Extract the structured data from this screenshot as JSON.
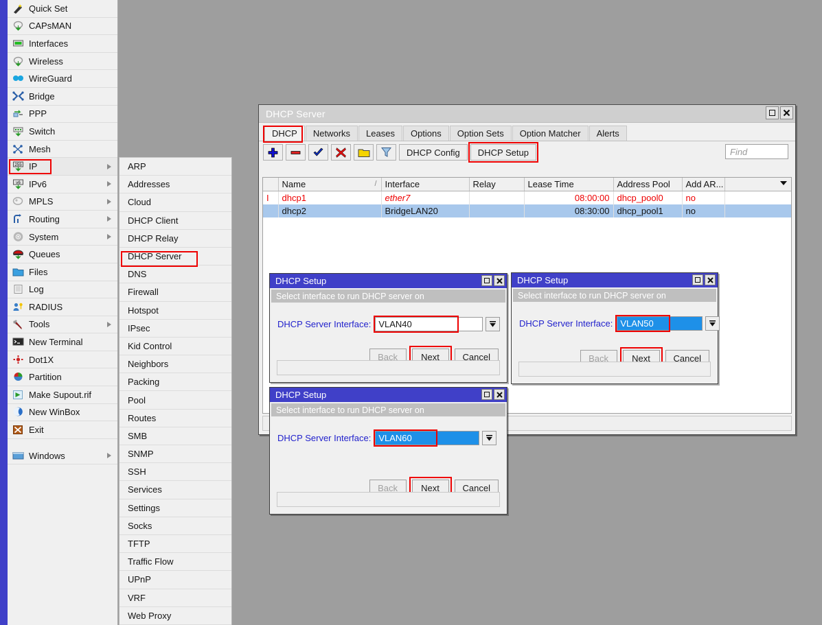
{
  "sidebar": {
    "items": [
      {
        "label": "Quick Set",
        "icon": "wand-icon",
        "submenu": false
      },
      {
        "label": "CAPsMAN",
        "icon": "capsman-icon",
        "submenu": false
      },
      {
        "label": "Interfaces",
        "icon": "interfaces-icon",
        "submenu": false
      },
      {
        "label": "Wireless",
        "icon": "wireless-icon",
        "submenu": false
      },
      {
        "label": "WireGuard",
        "icon": "wireguard-icon",
        "submenu": false
      },
      {
        "label": "Bridge",
        "icon": "bridge-icon",
        "submenu": false
      },
      {
        "label": "PPP",
        "icon": "ppp-icon",
        "submenu": false
      },
      {
        "label": "Switch",
        "icon": "switch-icon",
        "submenu": false
      },
      {
        "label": "Mesh",
        "icon": "mesh-icon",
        "submenu": false
      },
      {
        "label": "IP",
        "icon": "ip-icon",
        "submenu": true,
        "selected": true,
        "highlighted": true
      },
      {
        "label": "IPv6",
        "icon": "ipv6-icon",
        "submenu": true
      },
      {
        "label": "MPLS",
        "icon": "mpls-icon",
        "submenu": true
      },
      {
        "label": "Routing",
        "icon": "routing-icon",
        "submenu": true
      },
      {
        "label": "System",
        "icon": "system-gear-icon",
        "submenu": true
      },
      {
        "label": "Queues",
        "icon": "queues-icon",
        "submenu": false
      },
      {
        "label": "Files",
        "icon": "files-folder-icon",
        "submenu": false
      },
      {
        "label": "Log",
        "icon": "log-icon",
        "submenu": false
      },
      {
        "label": "RADIUS",
        "icon": "radius-icon",
        "submenu": false
      },
      {
        "label": "Tools",
        "icon": "tools-icon",
        "submenu": true
      },
      {
        "label": "New Terminal",
        "icon": "terminal-icon",
        "submenu": false
      },
      {
        "label": "Dot1X",
        "icon": "dot1x-icon",
        "submenu": false
      },
      {
        "label": "Partition",
        "icon": "partition-icon",
        "submenu": false
      },
      {
        "label": "Make Supout.rif",
        "icon": "supout-icon",
        "submenu": false
      },
      {
        "label": "New WinBox",
        "icon": "winbox-icon",
        "submenu": false
      },
      {
        "label": "Exit",
        "icon": "exit-icon",
        "submenu": false
      }
    ],
    "windows_item": {
      "label": "Windows",
      "icon": "windows-icon",
      "submenu": true
    }
  },
  "ip_submenu": {
    "items": [
      {
        "label": "ARP"
      },
      {
        "label": "Addresses"
      },
      {
        "label": "Cloud"
      },
      {
        "label": "DHCP Client"
      },
      {
        "label": "DHCP Relay"
      },
      {
        "label": "DHCP Server",
        "highlighted": true
      },
      {
        "label": "DNS"
      },
      {
        "label": "Firewall"
      },
      {
        "label": "Hotspot"
      },
      {
        "label": "IPsec"
      },
      {
        "label": "Kid Control"
      },
      {
        "label": "Neighbors"
      },
      {
        "label": "Packing"
      },
      {
        "label": "Pool"
      },
      {
        "label": "Routes"
      },
      {
        "label": "SMB"
      },
      {
        "label": "SNMP"
      },
      {
        "label": "SSH"
      },
      {
        "label": "Services"
      },
      {
        "label": "Settings"
      },
      {
        "label": "Socks"
      },
      {
        "label": "TFTP"
      },
      {
        "label": "Traffic Flow"
      },
      {
        "label": "UPnP"
      },
      {
        "label": "VRF"
      },
      {
        "label": "Web Proxy"
      }
    ]
  },
  "dhcp_window": {
    "title": "DHCP Server",
    "window_buttons": {
      "maximize": "□",
      "close": "✕"
    },
    "tabs": [
      {
        "label": "DHCP",
        "active": true,
        "highlighted": true
      },
      {
        "label": "Networks"
      },
      {
        "label": "Leases"
      },
      {
        "label": "Options"
      },
      {
        "label": "Option Sets"
      },
      {
        "label": "Option Matcher"
      },
      {
        "label": "Alerts"
      }
    ],
    "toolbar": {
      "add_icon": "plus-icon",
      "remove_icon": "minus-icon",
      "enable_icon": "check-icon",
      "disable_icon": "cross-icon",
      "comment_icon": "comment-folder-icon",
      "filter_icon": "filter-funnel-icon",
      "dhcp_config_label": "DHCP Config",
      "dhcp_setup_label": "DHCP Setup",
      "dhcp_setup_highlighted": true
    },
    "find": {
      "placeholder": "Find",
      "value": ""
    },
    "table": {
      "columns": [
        "",
        "Name",
        "Interface",
        "Relay",
        "Lease Time",
        "Address Pool",
        "Add AR..."
      ],
      "sort_column": "Name",
      "sort_indicator": "/",
      "rows": [
        {
          "flag": "I",
          "name": "dhcp1",
          "interface": "ether7",
          "relay": "",
          "lease_time": "08:00:00",
          "address_pool": "dhcp_pool0",
          "add_arp": "no",
          "state": "disabled"
        },
        {
          "flag": "",
          "name": "dhcp2",
          "interface": "BridgeLAN20",
          "relay": "",
          "lease_time": "08:30:00",
          "address_pool": "dhcp_pool1",
          "add_arp": "no",
          "state": "selected"
        }
      ]
    },
    "status_text": ""
  },
  "setup_dialogs": [
    {
      "id": "vlan40",
      "title": "DHCP Setup",
      "prompt": "Select interface to run DHCP server on",
      "field_label": "DHCP Server Interface:",
      "field_value": "VLAN40",
      "field_highlighted": false,
      "field_value_boxed": true,
      "buttons": [
        {
          "label": "Back",
          "disabled": true,
          "highlighted": false
        },
        {
          "label": "Next",
          "disabled": false,
          "highlighted": true
        },
        {
          "label": "Cancel",
          "disabled": false,
          "highlighted": false
        }
      ],
      "status_text": ""
    },
    {
      "id": "vlan50",
      "title": "DHCP Setup",
      "prompt": "Select interface to run DHCP server on",
      "field_label": "DHCP Server Interface:",
      "field_value": "VLAN50",
      "field_highlighted": true,
      "field_value_boxed": true,
      "buttons": [
        {
          "label": "Back",
          "disabled": true,
          "highlighted": false
        },
        {
          "label": "Next",
          "disabled": false,
          "highlighted": true
        },
        {
          "label": "Cancel",
          "disabled": false,
          "highlighted": false
        }
      ],
      "status_text": ""
    },
    {
      "id": "vlan60",
      "title": "DHCP Setup",
      "prompt": "Select interface to run DHCP server on",
      "field_label": "DHCP Server Interface:",
      "field_value": "VLAN60",
      "field_highlighted": true,
      "field_value_boxed": true,
      "buttons": [
        {
          "label": "Back",
          "disabled": true,
          "highlighted": false
        },
        {
          "label": "Next",
          "disabled": false,
          "highlighted": true
        },
        {
          "label": "Cancel",
          "disabled": false,
          "highlighted": false
        }
      ],
      "status_text": ""
    }
  ],
  "colors": {
    "desktop": "#9e9e9e",
    "sidebar_strip": "#4040c8",
    "panel": "#f0f0f0",
    "highlight_red": "#ee0000",
    "selection_blue": "#a8c8ec",
    "field_blue": "#1e90e8",
    "label_blue": "#2222cc",
    "disabled_red": "#ee0000",
    "title_blue": "#4040c8"
  }
}
